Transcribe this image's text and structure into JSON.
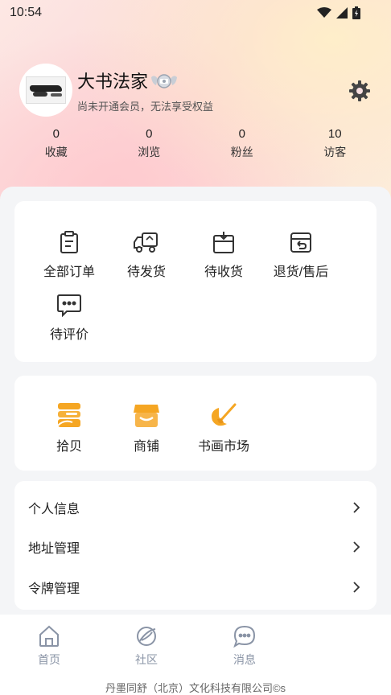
{
  "status_bar": {
    "time": "10:54"
  },
  "profile": {
    "username": "大书法家",
    "membership_note": "尚未开通会员，无法享受权益"
  },
  "stats": [
    {
      "value": "0",
      "label": "收藏"
    },
    {
      "value": "0",
      "label": "浏览"
    },
    {
      "value": "0",
      "label": "粉丝"
    },
    {
      "value": "10",
      "label": "访客"
    }
  ],
  "orders": [
    {
      "label": "全部订单",
      "icon": "clipboard-icon"
    },
    {
      "label": "待发货",
      "icon": "truck-icon"
    },
    {
      "label": "待收货",
      "icon": "package-icon"
    },
    {
      "label": "退货/售后",
      "icon": "return-box-icon"
    },
    {
      "label": "待评价",
      "icon": "chat-bubble-icon"
    }
  ],
  "services": [
    {
      "label": "拾贝",
      "icon": "stacked-cards-icon"
    },
    {
      "label": "商铺",
      "icon": "shop-icon"
    },
    {
      "label": "书画市场",
      "icon": "brush-palette-icon"
    }
  ],
  "settings": [
    {
      "label": "个人信息"
    },
    {
      "label": "地址管理"
    },
    {
      "label": "令牌管理"
    }
  ],
  "tabbar": [
    {
      "label": "首页",
      "icon": "home-icon"
    },
    {
      "label": "社区",
      "icon": "planet-icon"
    },
    {
      "label": "消息",
      "icon": "message-icon"
    }
  ],
  "footer": {
    "text": "丹墨同舒（北京）文化科技有限公司©s"
  },
  "colors": {
    "accent_orange": "#f5a623",
    "icon_dark": "#333333",
    "tab_gray": "#8a94a6"
  }
}
